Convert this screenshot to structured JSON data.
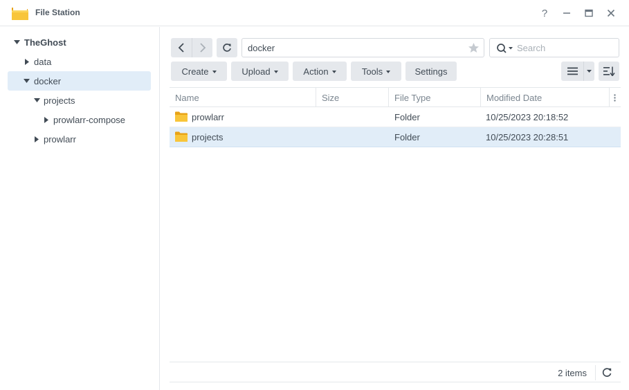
{
  "window": {
    "title": "File Station",
    "help_label": "?"
  },
  "sidebar": {
    "items": [
      {
        "label": "TheGhost",
        "expanded": true
      },
      {
        "label": "data",
        "expanded": false
      },
      {
        "label": "docker",
        "expanded": true,
        "selected": true
      },
      {
        "label": "projects",
        "expanded": true
      },
      {
        "label": "prowlarr-compose",
        "expanded": false
      },
      {
        "label": "prowlarr",
        "expanded": false
      }
    ]
  },
  "toolbar": {
    "path": "docker",
    "search_placeholder": "Search",
    "buttons": {
      "create": "Create",
      "upload": "Upload",
      "action": "Action",
      "tools": "Tools",
      "settings": "Settings"
    }
  },
  "table": {
    "columns": [
      "Name",
      "Size",
      "File Type",
      "Modified Date"
    ],
    "rows": [
      {
        "name": "prowlarr",
        "size": "",
        "type": "Folder",
        "modified": "10/25/2023 20:18:52",
        "selected": false
      },
      {
        "name": "projects",
        "size": "",
        "type": "Folder",
        "modified": "10/25/2023 20:28:51",
        "selected": true
      }
    ]
  },
  "footer": {
    "item_count": "2 items"
  },
  "colors": {
    "selection": "#e1edf8",
    "folder": "#f8c53a",
    "button_bg": "#e5e8ec"
  },
  "icons": [
    "file-station-app-icon",
    "help-icon",
    "minimize-icon",
    "maximize-icon",
    "close-icon",
    "back-icon",
    "forward-icon",
    "refresh-icon",
    "star-icon",
    "search-icon",
    "list-view-icon",
    "sort-icon",
    "folder-icon",
    "column-menu-icon"
  ]
}
